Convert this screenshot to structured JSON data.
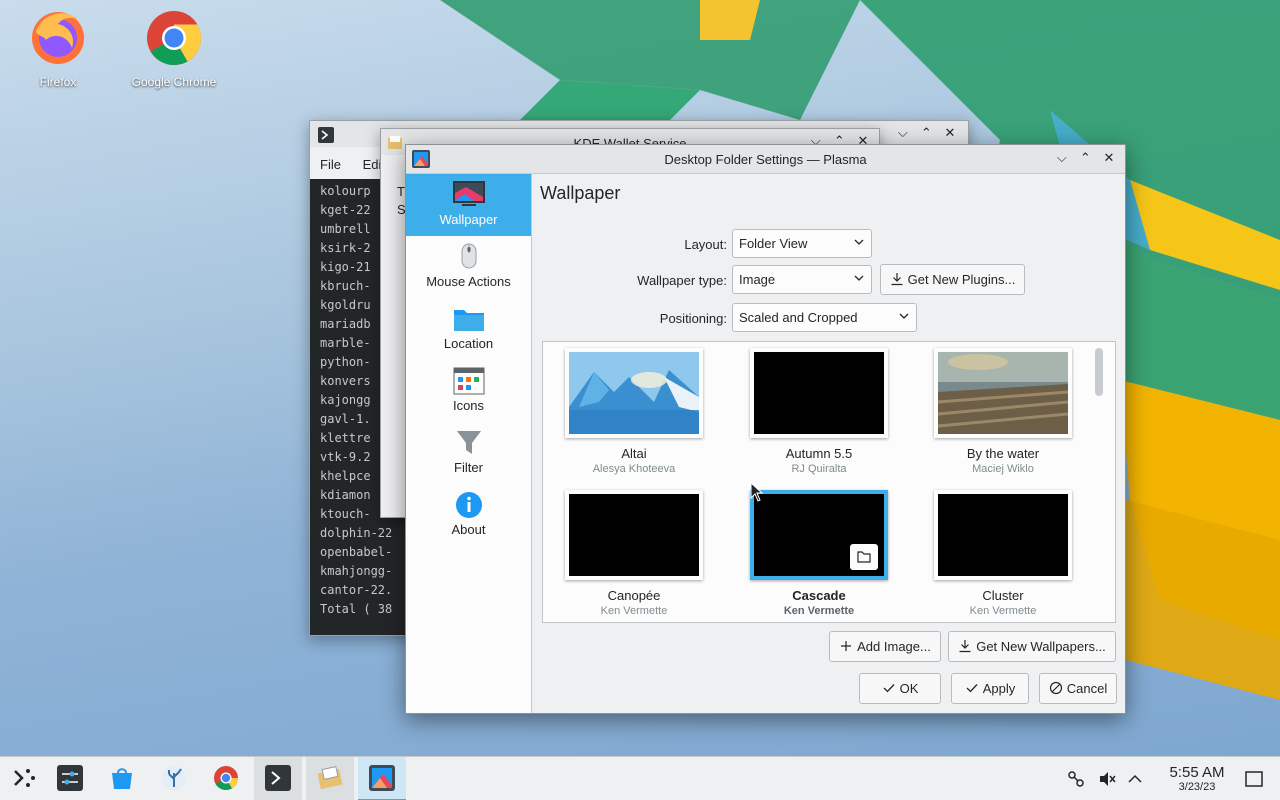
{
  "desktop": {
    "icons": [
      {
        "label": "Firefox",
        "icon": "firefox-icon"
      },
      {
        "label": "Google Chrome",
        "icon": "chrome-icon"
      }
    ]
  },
  "bg_windows": {
    "konsole": {
      "menu": [
        "File",
        "Edi"
      ],
      "lines": [
        "kolourp",
        "kget-22",
        "umbrell",
        "ksirk-2",
        "kigo-21",
        "kbruch-",
        "kgoldru",
        "mariadb",
        "marble-",
        "python-",
        "konvers",
        "kajongg",
        "gavl-1.",
        "klettre",
        "vtk-9.2",
        "khelpce",
        "kdiamon",
        "ktouch-",
        "dolphin-22",
        "openbabel-",
        "kmahjongg-",
        "cantor-22.",
        "Total ( 38"
      ]
    },
    "wallet": {
      "title": "KDE Wallet Service",
      "text_a": "Th",
      "text_b": "Sy"
    }
  },
  "dialog": {
    "title": "Desktop Folder Settings — Plasma",
    "page_title": "Wallpaper",
    "sidebar": [
      {
        "label": "Wallpaper",
        "icon": "wallpaper-icon",
        "active": true
      },
      {
        "label": "Mouse Actions",
        "icon": "mouse-icon",
        "active": false
      },
      {
        "label": "Location",
        "icon": "folder-icon",
        "active": false
      },
      {
        "label": "Icons",
        "icon": "icons-icon",
        "active": false
      },
      {
        "label": "Filter",
        "icon": "filter-icon",
        "active": false
      },
      {
        "label": "About",
        "icon": "info-icon",
        "active": false
      }
    ],
    "form": {
      "layout_label": "Layout:",
      "layout_value": "Folder View",
      "type_label": "Wallpaper type:",
      "type_value": "Image",
      "get_plugins": "Get New Plugins...",
      "positioning_label": "Positioning:",
      "positioning_value": "Scaled and Cropped"
    },
    "wallpapers": [
      {
        "name": "Altai",
        "author": "Alesya Khoteeva",
        "thumb": "altai"
      },
      {
        "name": "Autumn 5.5",
        "author": "RJ Quiralta",
        "thumb": "black"
      },
      {
        "name": "By the water",
        "author": "Maciej Wiklo",
        "thumb": "water"
      },
      {
        "name": "Canopée",
        "author": "Ken Vermette",
        "thumb": "black"
      },
      {
        "name": "Cascade",
        "author": "Ken Vermette",
        "thumb": "black",
        "selected": true
      },
      {
        "name": "Cluster",
        "author": "Ken Vermette",
        "thumb": "black"
      }
    ],
    "buttons": {
      "add_image": "Add Image...",
      "get_wallpapers": "Get New Wallpapers...",
      "ok": "OK",
      "apply": "Apply",
      "cancel": "Cancel"
    }
  },
  "taskbar": {
    "time": "5:55 AM",
    "date": "3/23/23"
  },
  "colors": {
    "accent": "#3daee9",
    "dialog_bg": "#eff0f1",
    "text": "#232629"
  }
}
